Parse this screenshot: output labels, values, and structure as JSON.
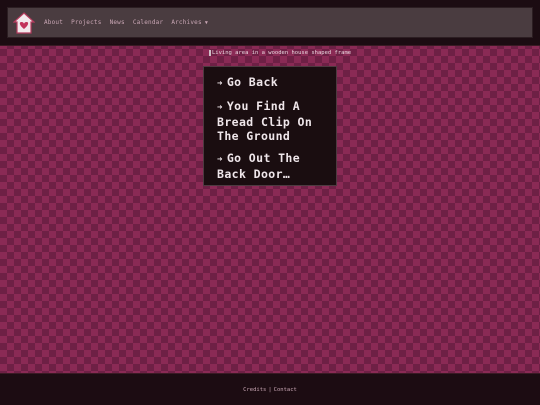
{
  "nav": {
    "items": [
      {
        "label": "About"
      },
      {
        "label": "Projects"
      },
      {
        "label": "News"
      },
      {
        "label": "Calendar"
      },
      {
        "label": "Archives"
      }
    ],
    "logo_icon": "heart-house-icon"
  },
  "main": {
    "image_alt": "Living area in a wooden house shaped frame",
    "choices": [
      {
        "arrow": "➜",
        "text": "Go Back"
      },
      {
        "arrow": "➜",
        "text": "You Find A Bread Clip On The Ground"
      },
      {
        "arrow": "➜",
        "text": "Go Out The Back Door…"
      }
    ]
  },
  "footer": {
    "credits": "Credits",
    "separator": "|",
    "contact": "Contact"
  },
  "colors": {
    "background": "#8a2a55",
    "checker": "#6e2045",
    "panel": "#1a0d10",
    "nav": "#4a3c40",
    "text": "#efe6ea"
  }
}
